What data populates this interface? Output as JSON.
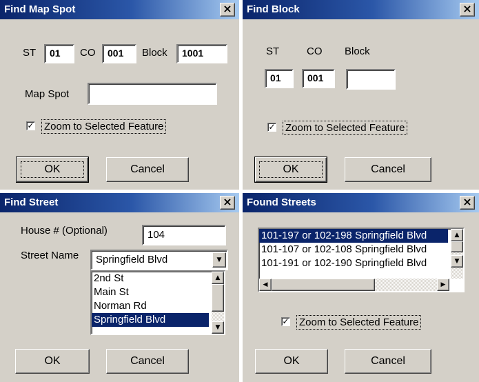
{
  "find_map_spot": {
    "title": "Find Map Spot",
    "close": "×",
    "st_label": "ST",
    "st_value": "01",
    "co_label": "CO",
    "co_value": "001",
    "block_label": "Block",
    "block_value": "1001",
    "map_spot_label": "Map Spot",
    "map_spot_value": "",
    "zoom_checked": true,
    "zoom_label": "Zoom to Selected Feature",
    "ok": "OK",
    "cancel": "Cancel"
  },
  "find_block": {
    "title": "Find Block",
    "close": "×",
    "st_label": "ST",
    "st_value": "01",
    "co_label": "CO",
    "co_value": "001",
    "block_label": "Block",
    "block_value": "",
    "zoom_checked": true,
    "zoom_label": "Zoom to Selected Feature",
    "ok": "OK",
    "cancel": "Cancel"
  },
  "find_street": {
    "title": "Find Street",
    "close": "×",
    "house_label": "House #  (Optional)",
    "house_value": "104",
    "street_label": "Street Name",
    "street_value": "Springfield Blvd",
    "options": [
      "2nd St",
      "Main St",
      "Norman Rd",
      "Springfield Blvd"
    ],
    "selected_option": "Springfield Blvd",
    "ok": "OK",
    "cancel": "Cancel"
  },
  "found_streets": {
    "title": "Found Streets",
    "close": "×",
    "results": [
      "101-197 or 102-198 Springfield Blvd",
      "101-107 or 102-108 Springfield Blvd",
      "101-191 or 102-190 Springfield Blvd"
    ],
    "selected_result": "101-197 or 102-198 Springfield Blvd",
    "zoom_checked": true,
    "zoom_label": "Zoom to Selected Feature",
    "ok": "OK",
    "cancel": "Cancel"
  },
  "colors": {
    "dialog_face": "#d4d0c8",
    "title_bar": "#0a246a",
    "selection": "#0a246a"
  },
  "icons": {
    "close": "close-icon",
    "scroll_up": "arrow-up-icon",
    "scroll_down": "arrow-down-icon",
    "scroll_left": "arrow-left-icon",
    "scroll_right": "arrow-right-icon",
    "dropdown": "chevron-down-icon",
    "check": "checkmark-icon"
  }
}
